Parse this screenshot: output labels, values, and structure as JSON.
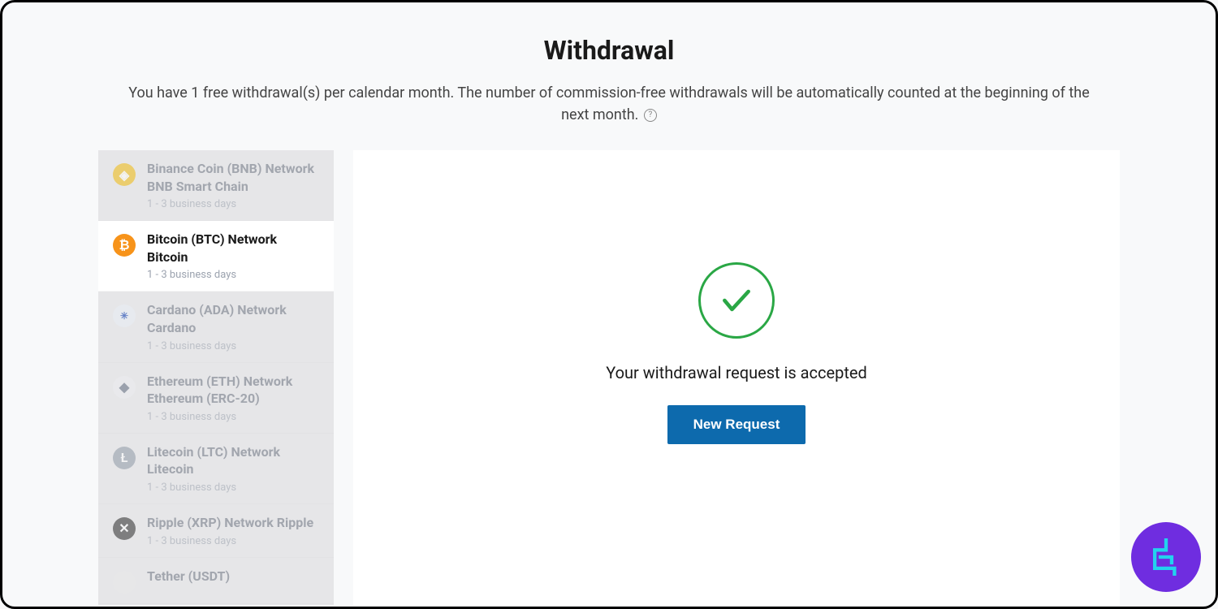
{
  "header": {
    "title": "Withdrawal",
    "subtitle": "You have 1 free withdrawal(s) per calendar month. The number of commission-free withdrawals will be automatically counted at the beginning of the next month."
  },
  "sidebar": {
    "items": [
      {
        "name": "Binance Coin (BNB) Network BNB Smart Chain",
        "time": "1 - 3 business days",
        "icon": "bnb",
        "glyph": "◈",
        "selected": false
      },
      {
        "name": "Bitcoin (BTC) Network Bitcoin",
        "time": "1 - 3 business days",
        "icon": "btc",
        "glyph": "₿",
        "selected": true
      },
      {
        "name": "Cardano (ADA) Network Cardano",
        "time": "1 - 3 business days",
        "icon": "ada",
        "glyph": "✳",
        "selected": false
      },
      {
        "name": "Ethereum (ETH) Network Ethereum (ERC-20)",
        "time": "1 - 3 business days",
        "icon": "eth",
        "glyph": "◆",
        "selected": false
      },
      {
        "name": "Litecoin (LTC) Network Litecoin",
        "time": "1 - 3 business days",
        "icon": "ltc",
        "glyph": "Ł",
        "selected": false
      },
      {
        "name": "Ripple (XRP) Network Ripple",
        "time": "1 - 3 business days",
        "icon": "xrp",
        "glyph": "✕",
        "selected": false
      },
      {
        "name": "Tether (USDT)",
        "time": "",
        "icon": "usdt",
        "glyph": "",
        "selected": false
      }
    ]
  },
  "main": {
    "success_message": "Your withdrawal request is accepted",
    "new_request_label": "New Request"
  },
  "colors": {
    "accent": "#0d6aad",
    "success": "#2aa745",
    "brand": "#6f2de0"
  }
}
